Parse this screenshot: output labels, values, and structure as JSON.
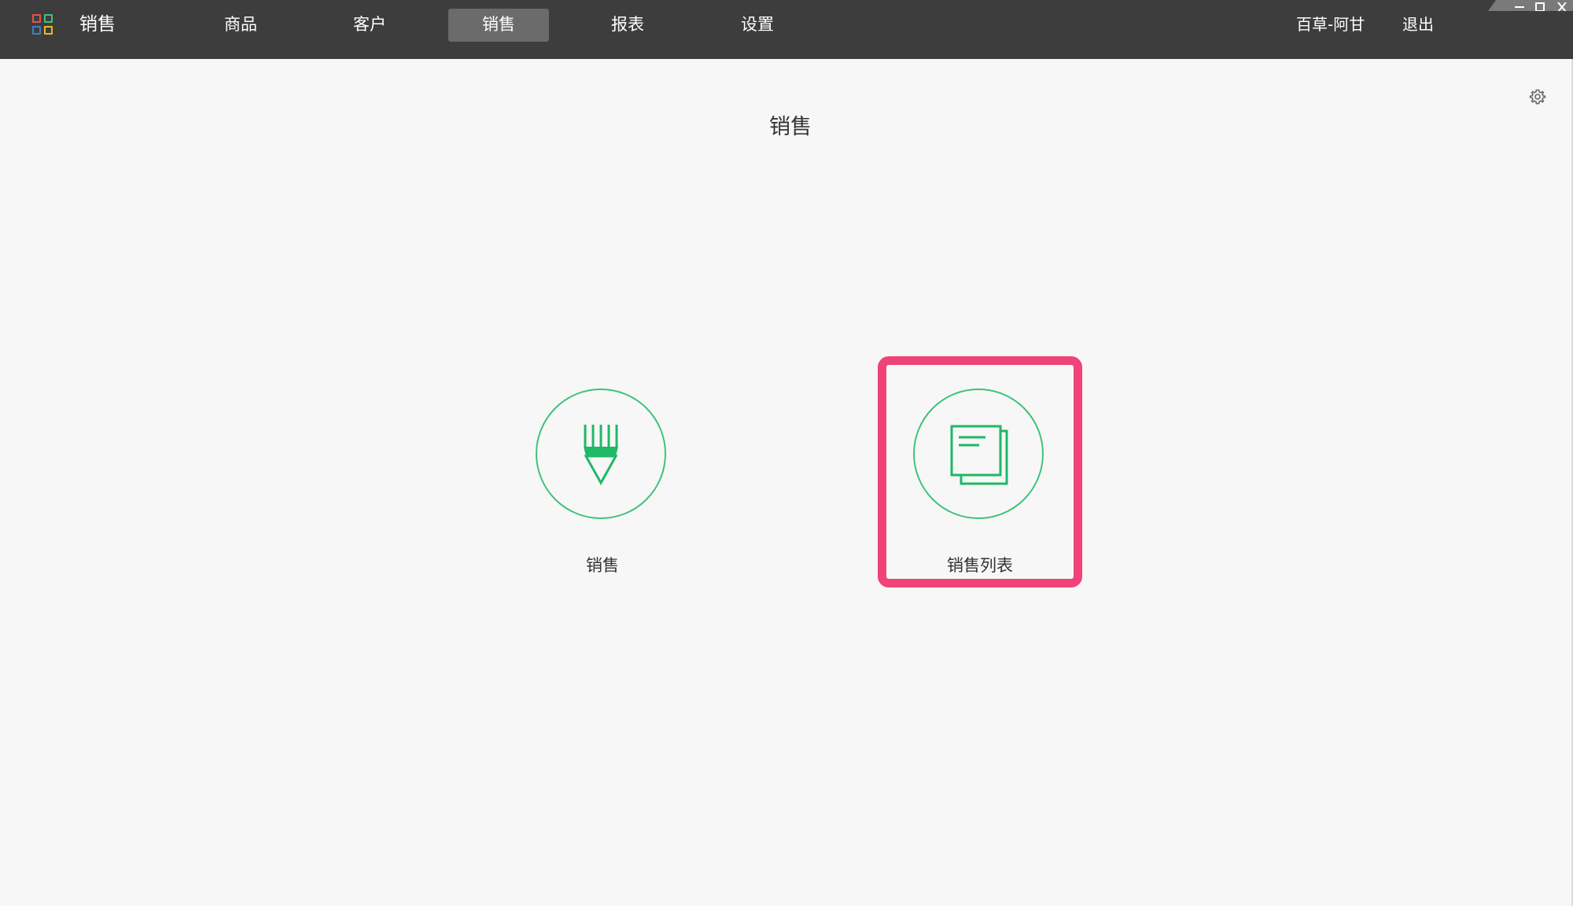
{
  "header": {
    "app_title": "销售",
    "app_icon": "grid-apps-icon",
    "app_icon_colors": [
      "#e8524a",
      "#3ec27a",
      "#3b82c4",
      "#f0b429"
    ],
    "nav": [
      {
        "label": "商品",
        "active": false
      },
      {
        "label": "客户",
        "active": false
      },
      {
        "label": "销售",
        "active": true
      },
      {
        "label": "报表",
        "active": false
      },
      {
        "label": "设置",
        "active": false
      }
    ],
    "user": "百草-阿甘",
    "logout": "退出"
  },
  "main": {
    "title": "销售",
    "settings_icon": "gear-icon",
    "tiles": [
      {
        "label": "销售",
        "icon": "pen-icon",
        "highlighted": false
      },
      {
        "label": "销售列表",
        "icon": "documents-icon",
        "highlighted": true
      }
    ]
  },
  "colors": {
    "topbar_bg": "#3d3d3d",
    "nav_active_bg": "#6b6b6b",
    "content_bg": "#f7f7f7",
    "accent_green": "#3ec27a",
    "highlight_pink": "#f0437a"
  }
}
